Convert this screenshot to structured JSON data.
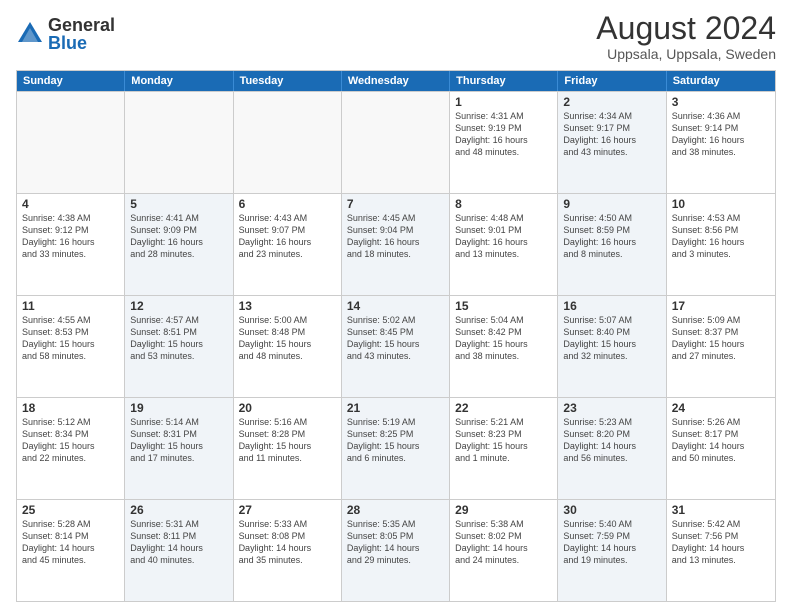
{
  "logo": {
    "general": "General",
    "blue": "Blue"
  },
  "header": {
    "month_year": "August 2024",
    "location": "Uppsala, Uppsala, Sweden"
  },
  "weekdays": [
    "Sunday",
    "Monday",
    "Tuesday",
    "Wednesday",
    "Thursday",
    "Friday",
    "Saturday"
  ],
  "weeks": [
    [
      {
        "day": "",
        "info": "",
        "shaded": false,
        "empty": true
      },
      {
        "day": "",
        "info": "",
        "shaded": false,
        "empty": true
      },
      {
        "day": "",
        "info": "",
        "shaded": false,
        "empty": true
      },
      {
        "day": "",
        "info": "",
        "shaded": false,
        "empty": true
      },
      {
        "day": "1",
        "info": "Sunrise: 4:31 AM\nSunset: 9:19 PM\nDaylight: 16 hours\nand 48 minutes.",
        "shaded": false,
        "empty": false
      },
      {
        "day": "2",
        "info": "Sunrise: 4:34 AM\nSunset: 9:17 PM\nDaylight: 16 hours\nand 43 minutes.",
        "shaded": true,
        "empty": false
      },
      {
        "day": "3",
        "info": "Sunrise: 4:36 AM\nSunset: 9:14 PM\nDaylight: 16 hours\nand 38 minutes.",
        "shaded": false,
        "empty": false
      }
    ],
    [
      {
        "day": "4",
        "info": "Sunrise: 4:38 AM\nSunset: 9:12 PM\nDaylight: 16 hours\nand 33 minutes.",
        "shaded": false,
        "empty": false
      },
      {
        "day": "5",
        "info": "Sunrise: 4:41 AM\nSunset: 9:09 PM\nDaylight: 16 hours\nand 28 minutes.",
        "shaded": true,
        "empty": false
      },
      {
        "day": "6",
        "info": "Sunrise: 4:43 AM\nSunset: 9:07 PM\nDaylight: 16 hours\nand 23 minutes.",
        "shaded": false,
        "empty": false
      },
      {
        "day": "7",
        "info": "Sunrise: 4:45 AM\nSunset: 9:04 PM\nDaylight: 16 hours\nand 18 minutes.",
        "shaded": true,
        "empty": false
      },
      {
        "day": "8",
        "info": "Sunrise: 4:48 AM\nSunset: 9:01 PM\nDaylight: 16 hours\nand 13 minutes.",
        "shaded": false,
        "empty": false
      },
      {
        "day": "9",
        "info": "Sunrise: 4:50 AM\nSunset: 8:59 PM\nDaylight: 16 hours\nand 8 minutes.",
        "shaded": true,
        "empty": false
      },
      {
        "day": "10",
        "info": "Sunrise: 4:53 AM\nSunset: 8:56 PM\nDaylight: 16 hours\nand 3 minutes.",
        "shaded": false,
        "empty": false
      }
    ],
    [
      {
        "day": "11",
        "info": "Sunrise: 4:55 AM\nSunset: 8:53 PM\nDaylight: 15 hours\nand 58 minutes.",
        "shaded": false,
        "empty": false
      },
      {
        "day": "12",
        "info": "Sunrise: 4:57 AM\nSunset: 8:51 PM\nDaylight: 15 hours\nand 53 minutes.",
        "shaded": true,
        "empty": false
      },
      {
        "day": "13",
        "info": "Sunrise: 5:00 AM\nSunset: 8:48 PM\nDaylight: 15 hours\nand 48 minutes.",
        "shaded": false,
        "empty": false
      },
      {
        "day": "14",
        "info": "Sunrise: 5:02 AM\nSunset: 8:45 PM\nDaylight: 15 hours\nand 43 minutes.",
        "shaded": true,
        "empty": false
      },
      {
        "day": "15",
        "info": "Sunrise: 5:04 AM\nSunset: 8:42 PM\nDaylight: 15 hours\nand 38 minutes.",
        "shaded": false,
        "empty": false
      },
      {
        "day": "16",
        "info": "Sunrise: 5:07 AM\nSunset: 8:40 PM\nDaylight: 15 hours\nand 32 minutes.",
        "shaded": true,
        "empty": false
      },
      {
        "day": "17",
        "info": "Sunrise: 5:09 AM\nSunset: 8:37 PM\nDaylight: 15 hours\nand 27 minutes.",
        "shaded": false,
        "empty": false
      }
    ],
    [
      {
        "day": "18",
        "info": "Sunrise: 5:12 AM\nSunset: 8:34 PM\nDaylight: 15 hours\nand 22 minutes.",
        "shaded": false,
        "empty": false
      },
      {
        "day": "19",
        "info": "Sunrise: 5:14 AM\nSunset: 8:31 PM\nDaylight: 15 hours\nand 17 minutes.",
        "shaded": true,
        "empty": false
      },
      {
        "day": "20",
        "info": "Sunrise: 5:16 AM\nSunset: 8:28 PM\nDaylight: 15 hours\nand 11 minutes.",
        "shaded": false,
        "empty": false
      },
      {
        "day": "21",
        "info": "Sunrise: 5:19 AM\nSunset: 8:25 PM\nDaylight: 15 hours\nand 6 minutes.",
        "shaded": true,
        "empty": false
      },
      {
        "day": "22",
        "info": "Sunrise: 5:21 AM\nSunset: 8:23 PM\nDaylight: 15 hours\nand 1 minute.",
        "shaded": false,
        "empty": false
      },
      {
        "day": "23",
        "info": "Sunrise: 5:23 AM\nSunset: 8:20 PM\nDaylight: 14 hours\nand 56 minutes.",
        "shaded": true,
        "empty": false
      },
      {
        "day": "24",
        "info": "Sunrise: 5:26 AM\nSunset: 8:17 PM\nDaylight: 14 hours\nand 50 minutes.",
        "shaded": false,
        "empty": false
      }
    ],
    [
      {
        "day": "25",
        "info": "Sunrise: 5:28 AM\nSunset: 8:14 PM\nDaylight: 14 hours\nand 45 minutes.",
        "shaded": false,
        "empty": false
      },
      {
        "day": "26",
        "info": "Sunrise: 5:31 AM\nSunset: 8:11 PM\nDaylight: 14 hours\nand 40 minutes.",
        "shaded": true,
        "empty": false
      },
      {
        "day": "27",
        "info": "Sunrise: 5:33 AM\nSunset: 8:08 PM\nDaylight: 14 hours\nand 35 minutes.",
        "shaded": false,
        "empty": false
      },
      {
        "day": "28",
        "info": "Sunrise: 5:35 AM\nSunset: 8:05 PM\nDaylight: 14 hours\nand 29 minutes.",
        "shaded": true,
        "empty": false
      },
      {
        "day": "29",
        "info": "Sunrise: 5:38 AM\nSunset: 8:02 PM\nDaylight: 14 hours\nand 24 minutes.",
        "shaded": false,
        "empty": false
      },
      {
        "day": "30",
        "info": "Sunrise: 5:40 AM\nSunset: 7:59 PM\nDaylight: 14 hours\nand 19 minutes.",
        "shaded": true,
        "empty": false
      },
      {
        "day": "31",
        "info": "Sunrise: 5:42 AM\nSunset: 7:56 PM\nDaylight: 14 hours\nand 13 minutes.",
        "shaded": false,
        "empty": false
      }
    ]
  ]
}
